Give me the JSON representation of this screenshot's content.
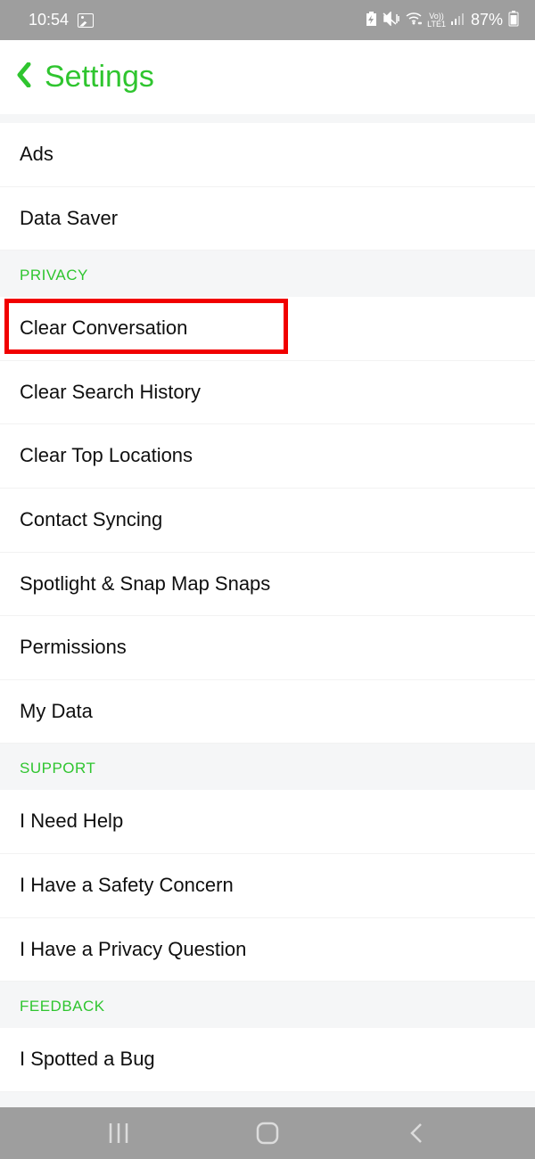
{
  "status": {
    "time": "10:54",
    "battery": "87%",
    "lte": "LTE1",
    "vol": "Vo))"
  },
  "header": {
    "title": "Settings"
  },
  "groups": [
    {
      "label": null,
      "items": [
        {
          "label": "Ads",
          "highlighted": false
        },
        {
          "label": "Data Saver",
          "highlighted": false
        }
      ]
    },
    {
      "label": "PRIVACY",
      "items": [
        {
          "label": "Clear Conversation",
          "highlighted": true
        },
        {
          "label": "Clear Search History",
          "highlighted": false
        },
        {
          "label": "Clear Top Locations",
          "highlighted": false
        },
        {
          "label": "Contact Syncing",
          "highlighted": false
        },
        {
          "label": "Spotlight & Snap Map Snaps",
          "highlighted": false
        },
        {
          "label": "Permissions",
          "highlighted": false
        },
        {
          "label": "My Data",
          "highlighted": false
        }
      ]
    },
    {
      "label": "SUPPORT",
      "items": [
        {
          "label": "I Need Help",
          "highlighted": false
        },
        {
          "label": "I Have a Safety Concern",
          "highlighted": false
        },
        {
          "label": "I Have a Privacy Question",
          "highlighted": false
        }
      ]
    },
    {
      "label": "FEEDBACK",
      "items": [
        {
          "label": "I Spotted a Bug",
          "highlighted": false
        }
      ]
    }
  ]
}
